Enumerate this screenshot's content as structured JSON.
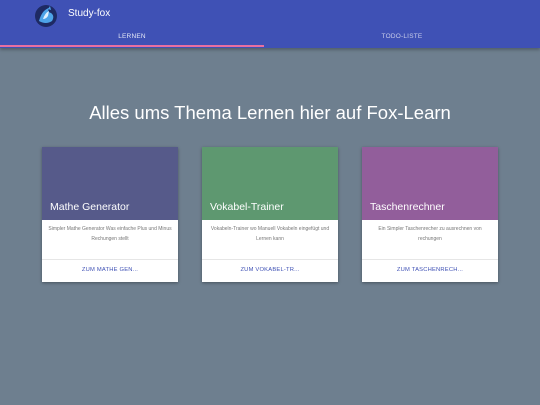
{
  "header": {
    "app_title": "Study-fox",
    "logo_icon": "fox-logo-icon",
    "background": "#3f51b5",
    "tabs": [
      {
        "label": "LERNEN",
        "active": true
      },
      {
        "label": "TODO-LISTE",
        "active": false
      }
    ],
    "indicator_color": "#e86fa0"
  },
  "main": {
    "headline": "Alles ums Thema Lernen hier auf Fox-Learn",
    "cards": [
      {
        "title": "Mathe Generator",
        "color": "#565a8a",
        "description": "Simpler Mathe Generator Was einfache Plus und Minus Rechungen stellt",
        "action": "ZUM MATHE GEN..."
      },
      {
        "title": "Vokabel-Trainer",
        "color": "#5e9870",
        "description": "Vokabeln-Trainer wo Manuell Vokabeln eingefügt und Lernen kann",
        "action": "ZUM VOKABEL-TR..."
      },
      {
        "title": "Taschenrechner",
        "color": "#925e9b",
        "description": "Ein Simpler Taschenrecher zu ausrechnen von rechungen",
        "action": "ZUM TASCHENRECH..."
      }
    ]
  }
}
